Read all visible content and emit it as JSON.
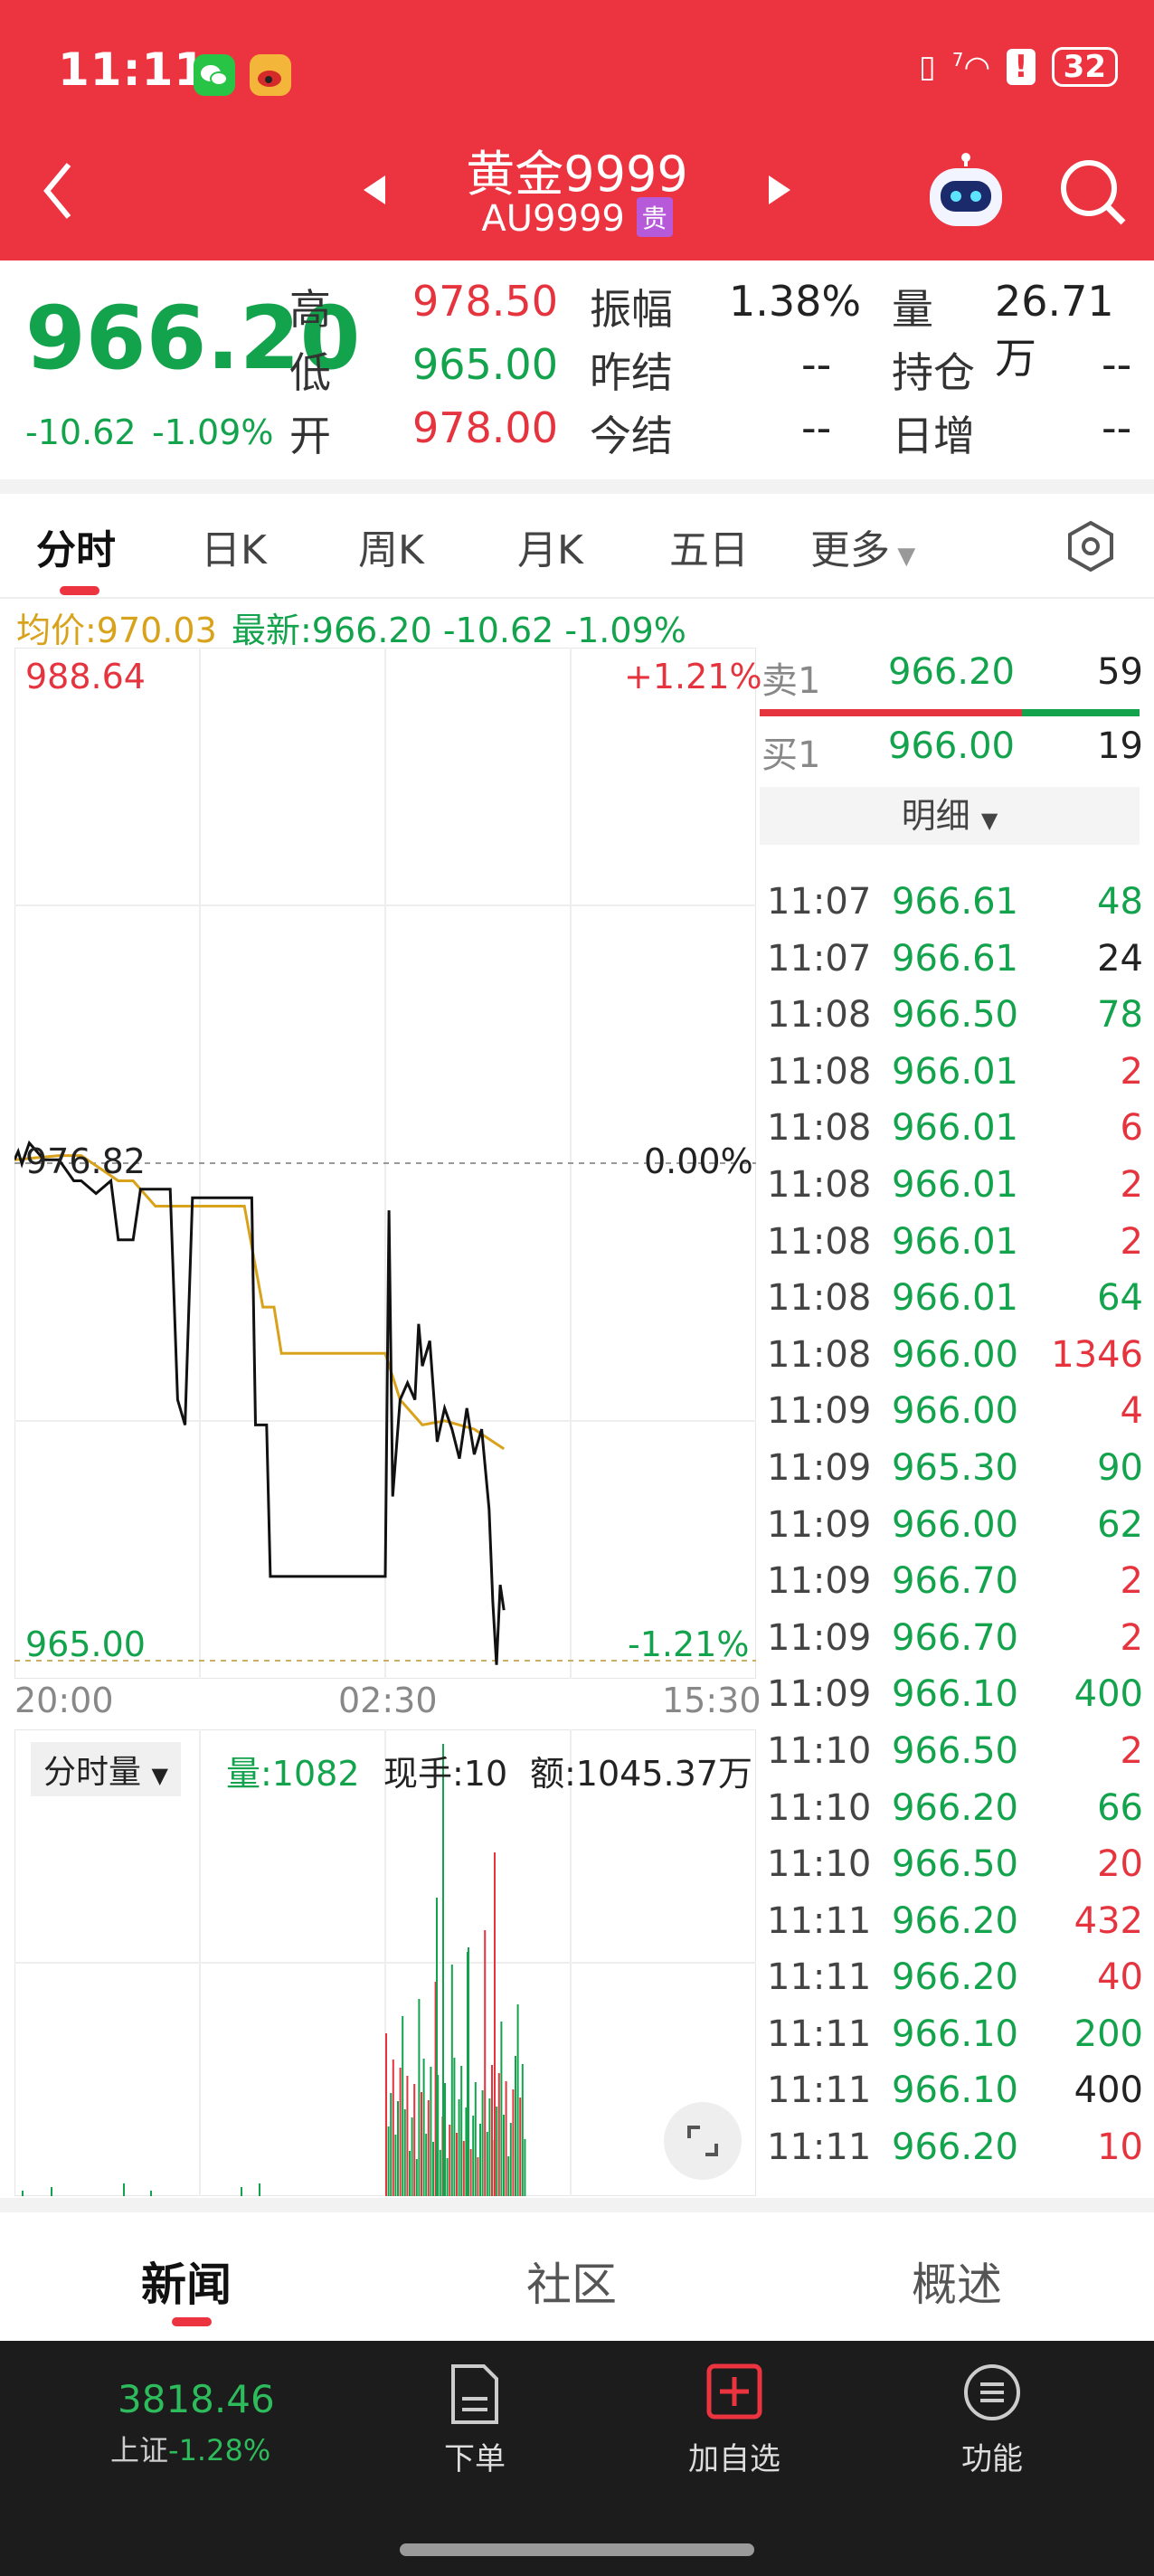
{
  "status_bar": {
    "time": "11:11",
    "signal_label": "7",
    "battery": "32"
  },
  "header": {
    "title": "黄金9999",
    "code": "AU9999",
    "badge": "贵"
  },
  "quote": {
    "last": "966.20",
    "change": "-10.62",
    "change_pct": "-1.09%",
    "rows": [
      {
        "l1": "高",
        "v1": "978.50",
        "l2": "振幅",
        "v2": "1.38%",
        "l3": "量",
        "v3": "26.71万"
      },
      {
        "l1": "低",
        "v1": "965.00",
        "l2": "昨结",
        "v2": "--",
        "l3": "持仓",
        "v3": "--"
      },
      {
        "l1": "开",
        "v1": "978.00",
        "l2": "今结",
        "v2": "--",
        "l3": "日增",
        "v3": "--"
      }
    ]
  },
  "tabs": [
    "分时",
    "日K",
    "周K",
    "月K",
    "五日",
    "更多"
  ],
  "info_line": {
    "avg_label": "均价:970.03",
    "latest_label": "最新:966.20 -10.62 -1.09%"
  },
  "chart_data": {
    "type": "line",
    "y_top_label": "988.64",
    "y_mid_label": "976.82",
    "y_bottom_label": "965.00",
    "pct_top_label": "+1.21%",
    "pct_mid_label": "0.00%",
    "pct_bottom_label": "-1.21%",
    "x_labels": [
      "20:00",
      "02:30",
      "15:30"
    ],
    "ylim": [
      965.0,
      988.64
    ],
    "price_series": [
      [
        0,
        976.9
      ],
      [
        0.005,
        977.1
      ],
      [
        0.01,
        976.8
      ],
      [
        0.02,
        977.3
      ],
      [
        0.04,
        976.9
      ],
      [
        0.06,
        976.9
      ],
      [
        0.08,
        976.4
      ],
      [
        0.09,
        976.4
      ],
      [
        0.11,
        976.1
      ],
      [
        0.13,
        976.4
      ],
      [
        0.14,
        975.0
      ],
      [
        0.16,
        975.0
      ],
      [
        0.17,
        976.2
      ],
      [
        0.21,
        976.2
      ],
      [
        0.22,
        971.2
      ],
      [
        0.23,
        970.6
      ],
      [
        0.24,
        976.0
      ],
      [
        0.32,
        976.0
      ],
      [
        0.325,
        970.6
      ],
      [
        0.34,
        970.6
      ],
      [
        0.345,
        967.0
      ],
      [
        0.5,
        967.0
      ],
      [
        0.505,
        975.7
      ],
      [
        0.51,
        968.9
      ],
      [
        0.52,
        971.2
      ],
      [
        0.53,
        971.6
      ],
      [
        0.54,
        971.2
      ],
      [
        0.545,
        973.0
      ],
      [
        0.55,
        972.0
      ],
      [
        0.56,
        972.6
      ],
      [
        0.57,
        970.2
      ],
      [
        0.58,
        971.0
      ],
      [
        0.59,
        970.5
      ],
      [
        0.6,
        969.8
      ],
      [
        0.61,
        971.0
      ],
      [
        0.62,
        969.9
      ],
      [
        0.63,
        970.5
      ],
      [
        0.64,
        968.6
      ],
      [
        0.645,
        966.4
      ],
      [
        0.65,
        964.9
      ],
      [
        0.655,
        966.8
      ],
      [
        0.66,
        966.2
      ]
    ],
    "avg_series": [
      [
        0,
        976.9
      ],
      [
        0.06,
        977.0
      ],
      [
        0.09,
        977.0
      ],
      [
        0.14,
        976.4
      ],
      [
        0.16,
        976.4
      ],
      [
        0.19,
        975.8
      ],
      [
        0.24,
        975.8
      ],
      [
        0.26,
        975.8
      ],
      [
        0.31,
        975.8
      ],
      [
        0.335,
        973.4
      ],
      [
        0.35,
        973.4
      ],
      [
        0.36,
        972.3
      ],
      [
        0.4,
        972.3
      ],
      [
        0.5,
        972.3
      ],
      [
        0.52,
        971.2
      ],
      [
        0.55,
        970.6
      ],
      [
        0.58,
        970.7
      ],
      [
        0.62,
        970.5
      ],
      [
        0.66,
        970.03
      ]
    ]
  },
  "order_book": {
    "sell1": {
      "label": "卖1",
      "price": "966.20",
      "qty": "59"
    },
    "buy1": {
      "label": "买1",
      "price": "966.00",
      "qty": "19"
    },
    "detail_label": "明细",
    "trades": [
      {
        "t": "11:07",
        "p": "966.61",
        "q": "48",
        "c": "green"
      },
      {
        "t": "11:07",
        "p": "966.61",
        "q": "24",
        "c": "black"
      },
      {
        "t": "11:08",
        "p": "966.50",
        "q": "78",
        "c": "green"
      },
      {
        "t": "11:08",
        "p": "966.01",
        "q": "2",
        "c": "red"
      },
      {
        "t": "11:08",
        "p": "966.01",
        "q": "6",
        "c": "red"
      },
      {
        "t": "11:08",
        "p": "966.01",
        "q": "2",
        "c": "red"
      },
      {
        "t": "11:08",
        "p": "966.01",
        "q": "2",
        "c": "red"
      },
      {
        "t": "11:08",
        "p": "966.01",
        "q": "64",
        "c": "green"
      },
      {
        "t": "11:08",
        "p": "966.00",
        "q": "1346",
        "c": "red"
      },
      {
        "t": "11:09",
        "p": "966.00",
        "q": "4",
        "c": "red"
      },
      {
        "t": "11:09",
        "p": "965.30",
        "q": "90",
        "c": "green"
      },
      {
        "t": "11:09",
        "p": "966.00",
        "q": "62",
        "c": "green"
      },
      {
        "t": "11:09",
        "p": "966.70",
        "q": "2",
        "c": "red"
      },
      {
        "t": "11:09",
        "p": "966.70",
        "q": "2",
        "c": "red"
      },
      {
        "t": "11:09",
        "p": "966.10",
        "q": "400",
        "c": "green"
      },
      {
        "t": "11:10",
        "p": "966.50",
        "q": "2",
        "c": "red"
      },
      {
        "t": "11:10",
        "p": "966.20",
        "q": "66",
        "c": "green"
      },
      {
        "t": "11:10",
        "p": "966.50",
        "q": "20",
        "c": "red"
      },
      {
        "t": "11:11",
        "p": "966.20",
        "q": "432",
        "c": "red"
      },
      {
        "t": "11:11",
        "p": "966.20",
        "q": "40",
        "c": "red"
      },
      {
        "t": "11:11",
        "p": "966.10",
        "q": "200",
        "c": "green"
      },
      {
        "t": "11:11",
        "p": "966.10",
        "q": "400",
        "c": "black"
      },
      {
        "t": "11:11",
        "p": "966.20",
        "q": "10",
        "c": "red"
      }
    ]
  },
  "volume": {
    "dropdown": "分时量",
    "vol": "量:1082",
    "cur": "现手:10",
    "amount": "额:1045.37万"
  },
  "bottom_tabs": [
    "新闻",
    "社区",
    "概述"
  ],
  "bottom_nav": {
    "index_value": "3818.46",
    "index_name": "上证",
    "index_change": "-1.28%",
    "order": "下单",
    "add": "加自选",
    "func": "功能"
  }
}
